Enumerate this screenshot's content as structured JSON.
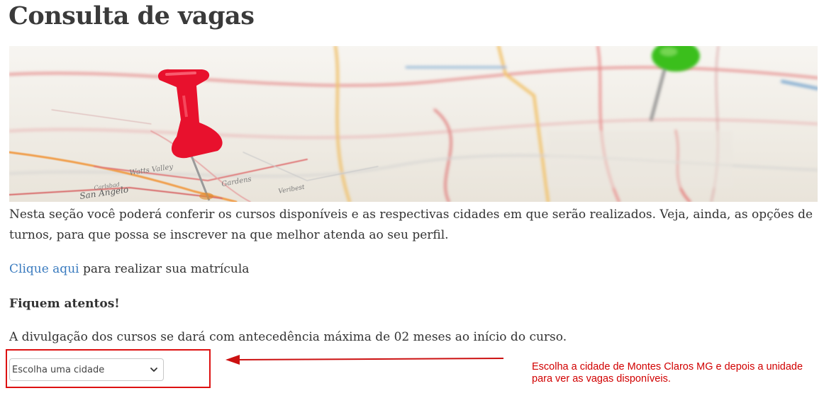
{
  "page": {
    "title": "Consulta de vagas"
  },
  "banner": {
    "image": "map-with-pins",
    "place_labels": [
      "Watts Valley",
      "Gardens",
      "San Angelo",
      "Carlsbad",
      "Veribest"
    ]
  },
  "intro_text": "Nesta seção você poderá conferir os cursos disponíveis e as respectivas cidades em que serão realizados. Veja, ainda, as opções de turnos, para que possa se inscrever na que melhor atenda ao seu perfil.",
  "enroll": {
    "link_label": "Clique aqui",
    "rest": " para realizar sua matrícula"
  },
  "attention_heading": "Fiquem atentos!",
  "notice_text": "A divulgação dos cursos se dará com antecedência máxima de 02 meses ao início do curso.",
  "city_select": {
    "selected": "Escolha uma cidade"
  },
  "annotation": {
    "text": "Escolha a cidade de Montes Claros MG e depois a unidade para ver as vagas disponíveis.",
    "color": "#d10000"
  },
  "colors": {
    "link": "#3a7bbf",
    "highlight": "#dd1111",
    "pin_red": "#e8112d",
    "pin_green": "#3bbf1a"
  }
}
